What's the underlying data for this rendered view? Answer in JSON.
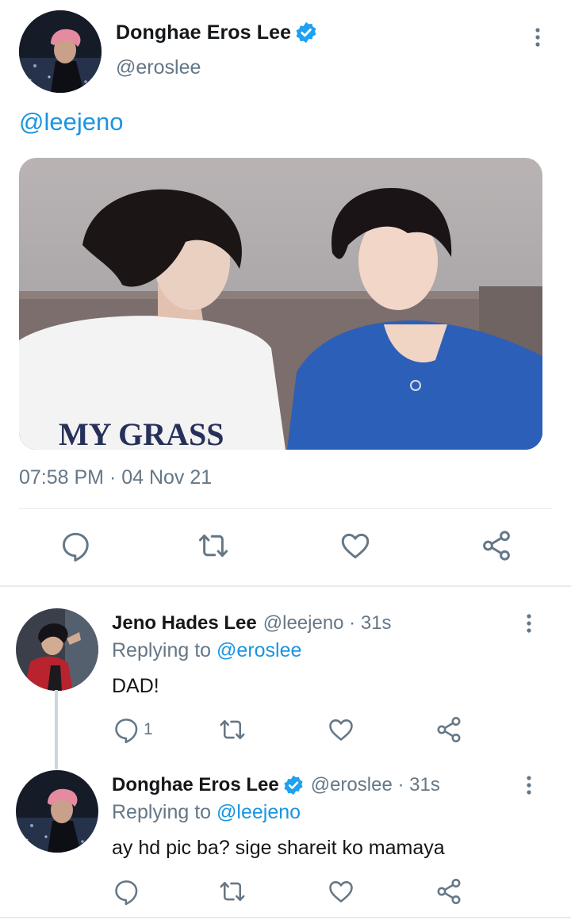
{
  "main_tweet": {
    "author_name": "Donghae Eros Lee",
    "author_handle": "@eroslee",
    "text": "@leejeno",
    "photo_text": "MY GRASS",
    "timestamp": "07:58 PM · 04 Nov 21"
  },
  "replies": [
    {
      "author_name": "Jeno Hades Lee",
      "meta": "@leejeno · 31s",
      "replying_label": "Replying to",
      "replying_to": "@eroslee",
      "text": "DAD!",
      "reply_count": "1"
    },
    {
      "author_name": "Donghae Eros Lee",
      "meta": "@eroslee · 31s",
      "replying_label": "Replying to",
      "replying_to": "@leejeno",
      "text": "ay hd pic ba? sige shareit ko mamaya",
      "reply_count": ""
    }
  ],
  "colors": {
    "link_blue": "#1b95e0",
    "verified_blue": "#1da1f2",
    "secondary_gray": "#657786"
  },
  "icons": [
    "verified-icon",
    "more-vertical-icon",
    "reply-icon",
    "retweet-icon",
    "like-icon",
    "share-icon"
  ]
}
